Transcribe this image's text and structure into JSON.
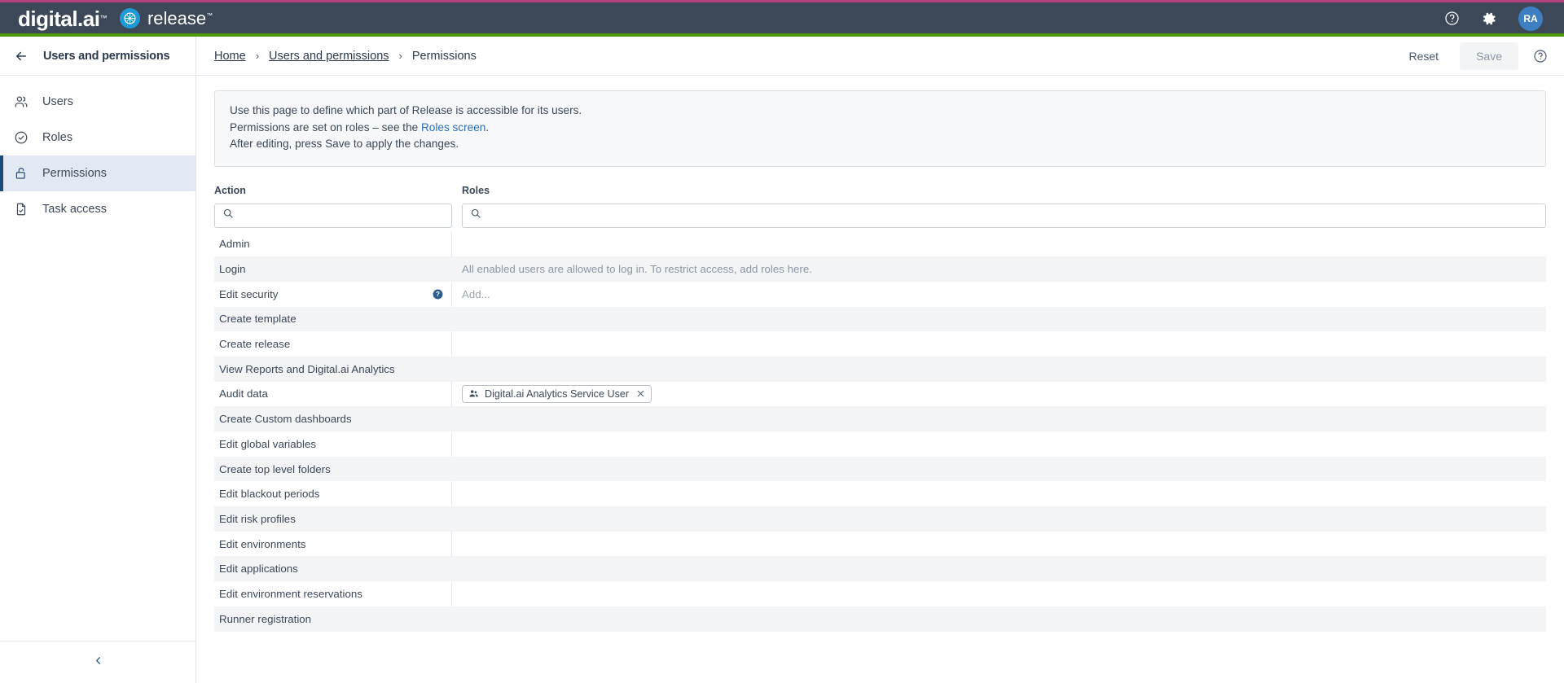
{
  "topbar": {
    "brand": "digital.ai",
    "brand_tm": "™",
    "product": "release",
    "product_tm": "™",
    "help_icon": "help-circle-icon",
    "settings_icon": "gear-icon",
    "avatar_initials": "RA",
    "accent_pink": "#b5427e",
    "accent_green": "#4e9a06",
    "bar_bg": "#3c4858",
    "release_blue": "#1e9ad6",
    "avatar_bg": "#3d7fc1"
  },
  "sidebar": {
    "back_icon": "arrow-left-icon",
    "title": "Users and permissions",
    "collapse_icon": "chevron-left-icon",
    "items": [
      {
        "label": "Users",
        "icon": "users-icon",
        "active": false
      },
      {
        "label": "Roles",
        "icon": "check-circle-icon",
        "active": false
      },
      {
        "label": "Permissions",
        "icon": "unlock-icon",
        "active": true
      },
      {
        "label": "Task access",
        "icon": "file-check-icon",
        "active": false
      }
    ],
    "active_bg": "#e3e9f4",
    "active_marker": "#1b4b78"
  },
  "breadcrumb": {
    "items": [
      {
        "label": "Home",
        "link": true
      },
      {
        "label": "Users and permissions",
        "link": true
      },
      {
        "label": "Permissions",
        "link": false
      }
    ],
    "separator": "›"
  },
  "actions": {
    "reset_label": "Reset",
    "save_label": "Save",
    "save_disabled": true,
    "help_icon": "help-circle-icon"
  },
  "infobox": {
    "line1": "Use this page to define which part of Release is accessible for its users.",
    "line2_pre": "Permissions are set on roles – see the ",
    "line2_link": "Roles screen",
    "line2_post": ".",
    "line3": "After editing, press Save to apply the changes.",
    "link_color": "#2f6fb5"
  },
  "table": {
    "col_action_title": "Action",
    "col_roles_title": "Roles",
    "search_action": {
      "value": "",
      "placeholder": "",
      "icon": "search-icon"
    },
    "search_roles": {
      "value": "",
      "placeholder": "",
      "icon": "search-icon"
    },
    "rows": [
      {
        "action": "Admin",
        "roles_kind": "empty",
        "roles_text": "",
        "help": false
      },
      {
        "action": "Login",
        "roles_kind": "note",
        "roles_text": "All enabled users are allowed to log in. To restrict access, add roles here.",
        "help": false
      },
      {
        "action": "Edit security",
        "roles_kind": "add",
        "roles_text": "Add...",
        "help": true
      },
      {
        "action": "Create template",
        "roles_kind": "empty",
        "roles_text": "",
        "help": false
      },
      {
        "action": "Create release",
        "roles_kind": "empty",
        "roles_text": "",
        "help": false
      },
      {
        "action": "View Reports and Digital.ai Analytics",
        "roles_kind": "empty",
        "roles_text": "",
        "help": false
      },
      {
        "action": "Audit data",
        "roles_kind": "chip",
        "roles_text": "Digital.ai Analytics Service User",
        "help": false
      },
      {
        "action": "Create Custom dashboards",
        "roles_kind": "empty",
        "roles_text": "",
        "help": false
      },
      {
        "action": "Edit global variables",
        "roles_kind": "empty",
        "roles_text": "",
        "help": false
      },
      {
        "action": "Create top level folders",
        "roles_kind": "empty",
        "roles_text": "",
        "help": false
      },
      {
        "action": "Edit blackout periods",
        "roles_kind": "empty",
        "roles_text": "",
        "help": false
      },
      {
        "action": "Edit risk profiles",
        "roles_kind": "empty",
        "roles_text": "",
        "help": false
      },
      {
        "action": "Edit environments",
        "roles_kind": "empty",
        "roles_text": "",
        "help": false
      },
      {
        "action": "Edit applications",
        "roles_kind": "empty",
        "roles_text": "",
        "help": false
      },
      {
        "action": "Edit environment reservations",
        "roles_kind": "empty",
        "roles_text": "",
        "help": false
      },
      {
        "action": "Runner registration",
        "roles_kind": "empty",
        "roles_text": "",
        "help": false
      }
    ],
    "chip_icon": "group-users-icon",
    "chip_remove_icon": "close-x-icon",
    "row_alt_bg": "#f3f4f6"
  }
}
